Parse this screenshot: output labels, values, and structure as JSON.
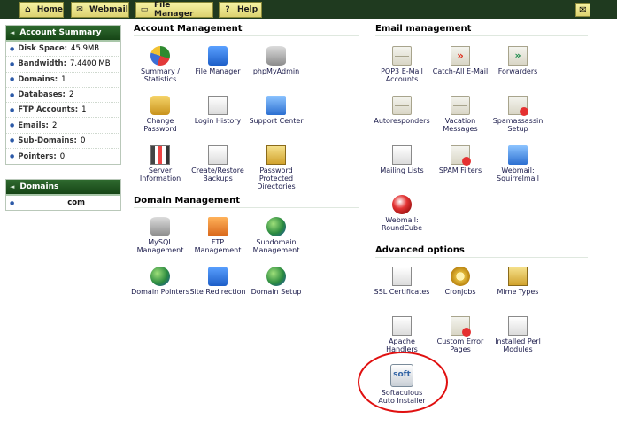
{
  "topbar": {
    "buttons": [
      {
        "label": "Home",
        "icon": "home-icon"
      },
      {
        "label": "Webmail",
        "icon": "mail-icon"
      },
      {
        "label": "File Manager",
        "icon": "folder-icon"
      },
      {
        "label": "Help",
        "icon": "help-icon"
      }
    ],
    "right_icon": "envelope-icon"
  },
  "account_summary": {
    "title": "Account Summary",
    "rows": [
      {
        "label": "Disk Space:",
        "value": "45.9MB"
      },
      {
        "label": "Bandwidth:",
        "value": "7.4400 MB"
      },
      {
        "label": "Domains:",
        "value": "1"
      },
      {
        "label": "Databases:",
        "value": "2"
      },
      {
        "label": "FTP Accounts:",
        "value": "1"
      },
      {
        "label": "Emails:",
        "value": "2"
      },
      {
        "label": "Sub-Domains:",
        "value": "0"
      },
      {
        "label": "Pointers:",
        "value": "0"
      }
    ]
  },
  "domains_panel": {
    "title": "Domains",
    "items": [
      {
        "value": "com"
      }
    ]
  },
  "sections": {
    "account_management": {
      "title": "Account Management",
      "items": [
        {
          "label": "Summary / Statistics",
          "icon": "pie-chart-icon"
        },
        {
          "label": "File Manager",
          "icon": "folder-icon"
        },
        {
          "label": "phpMyAdmin",
          "icon": "database-icon"
        },
        {
          "label": "Change Password",
          "icon": "lock-icon"
        },
        {
          "label": "Login History",
          "icon": "calendar-icon"
        },
        {
          "label": "Support Center",
          "icon": "support-icon"
        },
        {
          "label": "Server Information",
          "icon": "server-icon"
        },
        {
          "label": "Create/Restore Backups",
          "icon": "backup-icon"
        },
        {
          "label": "Password Protected Directories",
          "icon": "protected-folder-icon"
        }
      ]
    },
    "domain_management": {
      "title": "Domain Management",
      "items": [
        {
          "label": "MySQL Management",
          "icon": "database-icon"
        },
        {
          "label": "FTP Management",
          "icon": "ftp-icon"
        },
        {
          "label": "Subdomain Management",
          "icon": "globe-icon"
        },
        {
          "label": "Domain Pointers",
          "icon": "globe-icon"
        },
        {
          "label": "Site Redirection",
          "icon": "redirect-icon"
        },
        {
          "label": "Domain Setup",
          "icon": "globe-icon"
        }
      ]
    },
    "email_management": {
      "title": "Email management",
      "items": [
        {
          "label": "POP3 E-Mail Accounts",
          "icon": "envelope-icon"
        },
        {
          "label": "Catch-All E-Mail",
          "icon": "catch-all-icon"
        },
        {
          "label": "Forwarders",
          "icon": "forward-icon"
        },
        {
          "label": "Autoresponders",
          "icon": "autoresponder-icon"
        },
        {
          "label": "Vacation Messages",
          "icon": "vacation-icon"
        },
        {
          "label": "Spamassassin Setup",
          "icon": "spam-icon"
        },
        {
          "label": "Mailing Lists",
          "icon": "mailing-list-icon"
        },
        {
          "label": "SPAM Filters",
          "icon": "spam-filter-icon"
        },
        {
          "label": "Webmail: Squirrelmail",
          "icon": "monitor-icon"
        },
        {
          "label": "Webmail: RoundCube",
          "icon": "roundcube-icon"
        }
      ]
    },
    "advanced_options": {
      "title": "Advanced options",
      "items": [
        {
          "label": "SSL Certificates",
          "icon": "certificate-icon"
        },
        {
          "label": "Cronjobs",
          "icon": "cron-icon"
        },
        {
          "label": "Mime Types",
          "icon": "mime-icon"
        },
        {
          "label": "Apache Handlers",
          "icon": "apache-icon"
        },
        {
          "label": "Custom Error Pages",
          "icon": "error-page-icon"
        },
        {
          "label": "Installed Perl Modules",
          "icon": "perl-icon"
        },
        {
          "label": "Softaculous Auto Installer",
          "icon": "softaculous-icon",
          "icon_text": "soft"
        }
      ]
    }
  },
  "colors": {
    "topbar": "#1f3a1f",
    "button": "#f1ec9a",
    "panel_header": "#235a23",
    "highlight": "#e01010"
  }
}
